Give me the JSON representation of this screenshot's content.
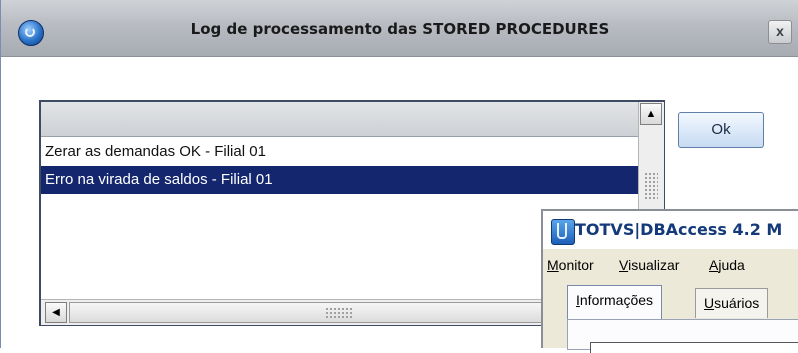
{
  "dialog": {
    "title": "Log de processamento das STORED PROCEDURES",
    "close_label": "x",
    "list": {
      "rows": [
        "Zerar as demandas OK - Filial 01",
        "Erro na virada de saldos - Filial 01"
      ],
      "selected_index": 1
    },
    "ok_label": "Ok"
  },
  "totvs_window": {
    "title": "TOTVS|DBAccess 4.2 M",
    "menu": {
      "monitor": {
        "mnemonic": "M",
        "rest": "onitor"
      },
      "visualizar": {
        "mnemonic": "V",
        "rest": "isualizar"
      },
      "ajuda": {
        "mnemonic": "A",
        "rest": "juda"
      }
    },
    "tabs": {
      "informacoes": {
        "mnemonic": "I",
        "rest": "nformações"
      },
      "usuarios": {
        "mnemonic": "U",
        "rest": "suários"
      }
    }
  },
  "colors": {
    "selection": "#14266e",
    "titlebar": "#b8bcc2",
    "ok_button": "#c7dbf2"
  },
  "icons": [
    "app-globe-icon",
    "close-icon",
    "scroll-up-arrow-icon",
    "scroll-left-arrow-icon",
    "totvs-app-icon"
  ]
}
